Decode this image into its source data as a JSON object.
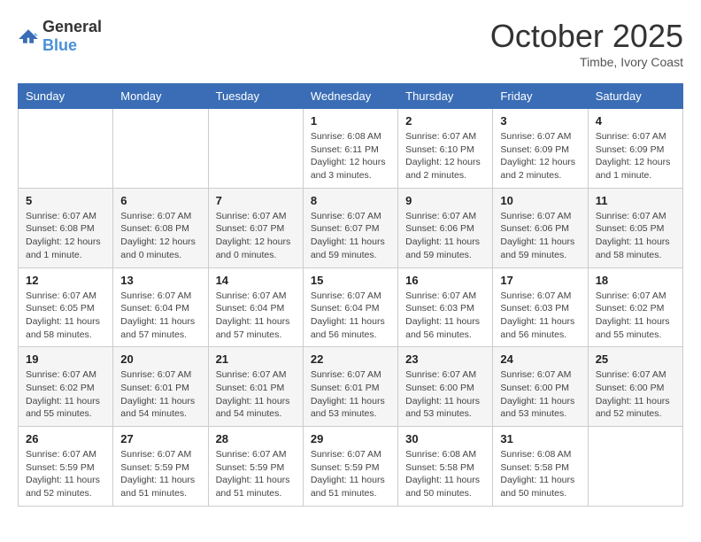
{
  "header": {
    "logo_general": "General",
    "logo_blue": "Blue",
    "month_title": "October 2025",
    "location": "Timbe, Ivory Coast"
  },
  "weekdays": [
    "Sunday",
    "Monday",
    "Tuesday",
    "Wednesday",
    "Thursday",
    "Friday",
    "Saturday"
  ],
  "weeks": [
    [
      null,
      null,
      null,
      {
        "day": 1,
        "sunrise": "6:08 AM",
        "sunset": "6:11 PM",
        "daylight": "12 hours and 3 minutes."
      },
      {
        "day": 2,
        "sunrise": "6:07 AM",
        "sunset": "6:10 PM",
        "daylight": "12 hours and 2 minutes."
      },
      {
        "day": 3,
        "sunrise": "6:07 AM",
        "sunset": "6:09 PM",
        "daylight": "12 hours and 2 minutes."
      },
      {
        "day": 4,
        "sunrise": "6:07 AM",
        "sunset": "6:09 PM",
        "daylight": "12 hours and 1 minute."
      }
    ],
    [
      {
        "day": 5,
        "sunrise": "6:07 AM",
        "sunset": "6:08 PM",
        "daylight": "12 hours and 1 minute."
      },
      {
        "day": 6,
        "sunrise": "6:07 AM",
        "sunset": "6:08 PM",
        "daylight": "12 hours and 0 minutes."
      },
      {
        "day": 7,
        "sunrise": "6:07 AM",
        "sunset": "6:07 PM",
        "daylight": "12 hours and 0 minutes."
      },
      {
        "day": 8,
        "sunrise": "6:07 AM",
        "sunset": "6:07 PM",
        "daylight": "11 hours and 59 minutes."
      },
      {
        "day": 9,
        "sunrise": "6:07 AM",
        "sunset": "6:06 PM",
        "daylight": "11 hours and 59 minutes."
      },
      {
        "day": 10,
        "sunrise": "6:07 AM",
        "sunset": "6:06 PM",
        "daylight": "11 hours and 59 minutes."
      },
      {
        "day": 11,
        "sunrise": "6:07 AM",
        "sunset": "6:05 PM",
        "daylight": "11 hours and 58 minutes."
      }
    ],
    [
      {
        "day": 12,
        "sunrise": "6:07 AM",
        "sunset": "6:05 PM",
        "daylight": "11 hours and 58 minutes."
      },
      {
        "day": 13,
        "sunrise": "6:07 AM",
        "sunset": "6:04 PM",
        "daylight": "11 hours and 57 minutes."
      },
      {
        "day": 14,
        "sunrise": "6:07 AM",
        "sunset": "6:04 PM",
        "daylight": "11 hours and 57 minutes."
      },
      {
        "day": 15,
        "sunrise": "6:07 AM",
        "sunset": "6:04 PM",
        "daylight": "11 hours and 56 minutes."
      },
      {
        "day": 16,
        "sunrise": "6:07 AM",
        "sunset": "6:03 PM",
        "daylight": "11 hours and 56 minutes."
      },
      {
        "day": 17,
        "sunrise": "6:07 AM",
        "sunset": "6:03 PM",
        "daylight": "11 hours and 56 minutes."
      },
      {
        "day": 18,
        "sunrise": "6:07 AM",
        "sunset": "6:02 PM",
        "daylight": "11 hours and 55 minutes."
      }
    ],
    [
      {
        "day": 19,
        "sunrise": "6:07 AM",
        "sunset": "6:02 PM",
        "daylight": "11 hours and 55 minutes."
      },
      {
        "day": 20,
        "sunrise": "6:07 AM",
        "sunset": "6:01 PM",
        "daylight": "11 hours and 54 minutes."
      },
      {
        "day": 21,
        "sunrise": "6:07 AM",
        "sunset": "6:01 PM",
        "daylight": "11 hours and 54 minutes."
      },
      {
        "day": 22,
        "sunrise": "6:07 AM",
        "sunset": "6:01 PM",
        "daylight": "11 hours and 53 minutes."
      },
      {
        "day": 23,
        "sunrise": "6:07 AM",
        "sunset": "6:00 PM",
        "daylight": "11 hours and 53 minutes."
      },
      {
        "day": 24,
        "sunrise": "6:07 AM",
        "sunset": "6:00 PM",
        "daylight": "11 hours and 53 minutes."
      },
      {
        "day": 25,
        "sunrise": "6:07 AM",
        "sunset": "6:00 PM",
        "daylight": "11 hours and 52 minutes."
      }
    ],
    [
      {
        "day": 26,
        "sunrise": "6:07 AM",
        "sunset": "5:59 PM",
        "daylight": "11 hours and 52 minutes."
      },
      {
        "day": 27,
        "sunrise": "6:07 AM",
        "sunset": "5:59 PM",
        "daylight": "11 hours and 51 minutes."
      },
      {
        "day": 28,
        "sunrise": "6:07 AM",
        "sunset": "5:59 PM",
        "daylight": "11 hours and 51 minutes."
      },
      {
        "day": 29,
        "sunrise": "6:07 AM",
        "sunset": "5:59 PM",
        "daylight": "11 hours and 51 minutes."
      },
      {
        "day": 30,
        "sunrise": "6:08 AM",
        "sunset": "5:58 PM",
        "daylight": "11 hours and 50 minutes."
      },
      {
        "day": 31,
        "sunrise": "6:08 AM",
        "sunset": "5:58 PM",
        "daylight": "11 hours and 50 minutes."
      },
      null
    ]
  ]
}
